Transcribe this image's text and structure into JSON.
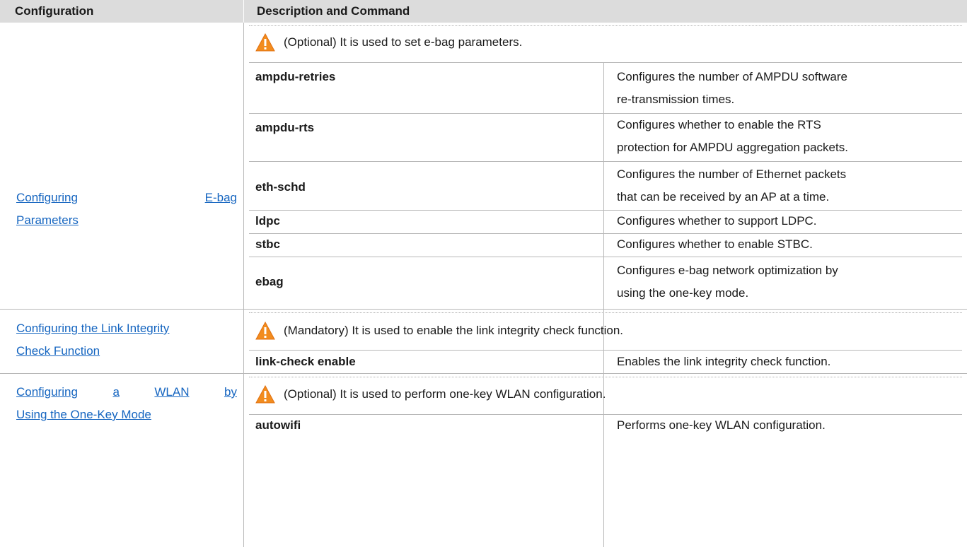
{
  "table": {
    "headers": {
      "configuration": "Configuration",
      "description": "Description and Command"
    },
    "sections": [
      {
        "config_line1": [
          "Configuring",
          "E-bag"
        ],
        "config_line2": "Parameters",
        "notice": "(Optional) It is used to set e-bag parameters.",
        "rows": [
          {
            "command": "ampdu-retries",
            "desc1": "Configures the number of AMPDU software",
            "desc2": "re-transmission times."
          },
          {
            "command": "ampdu-rts",
            "desc1": "Configures whether to enable the RTS",
            "desc2": "protection for AMPDU aggregation packets."
          },
          {
            "command": "eth-schd",
            "desc1": "Configures the number of Ethernet packets",
            "desc2": "that can be received by an AP at a time."
          },
          {
            "command": "ldpc",
            "desc1": "Configures whether to support LDPC."
          },
          {
            "command": "stbc",
            "desc1": "Configures whether to enable STBC."
          },
          {
            "command": "ebag",
            "desc1": "Configures e-bag network optimization by",
            "desc2": "using the one-key mode."
          }
        ]
      },
      {
        "config_line1": "Configuring the Link Integrity",
        "config_line2": "Check Function",
        "notice": "(Mandatory) It is used to enable the link integrity check function.",
        "rows": [
          {
            "command": "link-check enable",
            "desc1": "Enables the link integrity check function."
          }
        ]
      },
      {
        "config_line1": [
          "Configuring",
          "a",
          "WLAN",
          "by"
        ],
        "config_line2": "Using the One-Key Mode",
        "notice": "(Optional) It is used to perform one-key WLAN configuration.",
        "rows": [
          {
            "command": "autowifi",
            "desc1": "Performs one-key WLAN configuration."
          }
        ]
      }
    ]
  },
  "icons": {
    "notice_icon": "warning-triangle-icon"
  },
  "colors": {
    "header_bg": "#dcdcdc",
    "link": "#1565c0",
    "warn_orange": "#f28c1e"
  }
}
